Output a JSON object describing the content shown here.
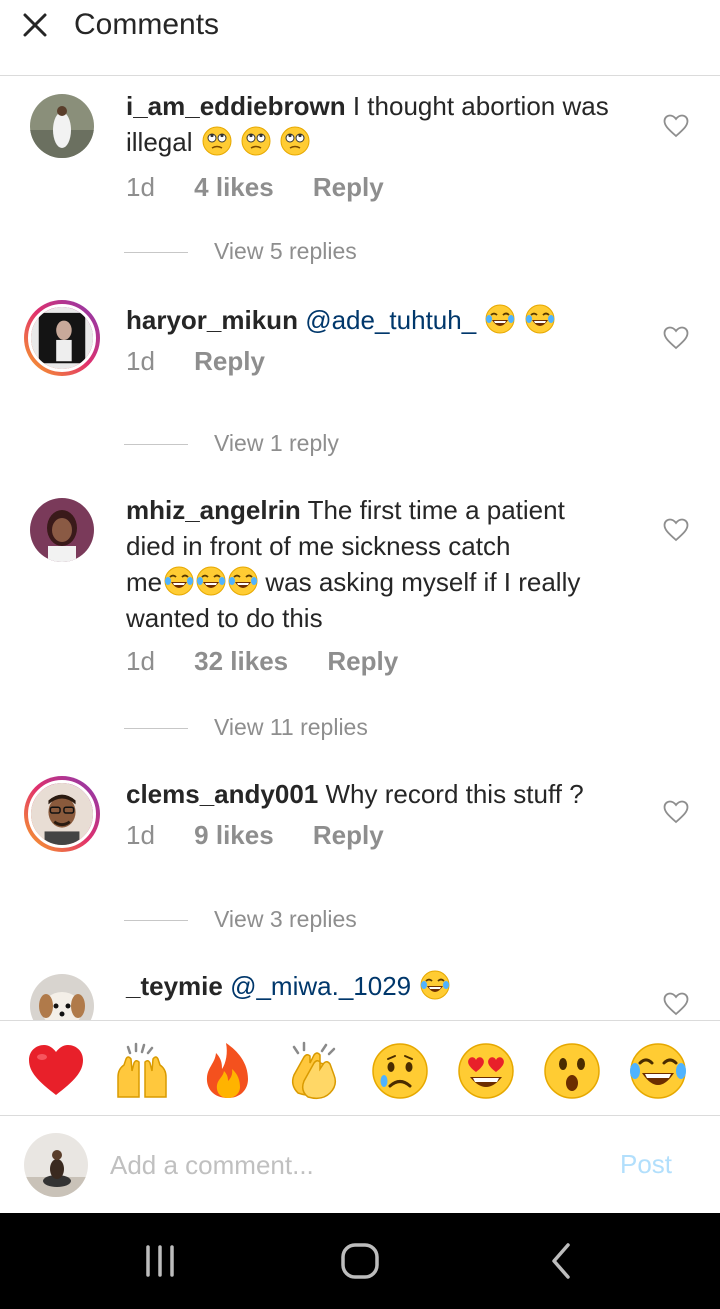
{
  "header": {
    "title": "Comments"
  },
  "comments": [
    {
      "username": "i_am_eddiebrown",
      "text": "I thought abortion was",
      "text_line2": "illegal",
      "emojis": [
        "eye-roll-emoji",
        "eye-roll-emoji",
        "eye-roll-emoji"
      ],
      "time": "1d",
      "likes": "4 likes",
      "reply": "Reply",
      "view_replies": "View 5 replies"
    },
    {
      "username": "haryor_mikun",
      "mention": "@ade_tuhtuh_",
      "emojis": [
        "tears-of-joy-emoji",
        "tears-of-joy-emoji"
      ],
      "time": "1d",
      "reply": "Reply",
      "view_replies": "View 1 reply"
    },
    {
      "username": "mhiz_angelrin",
      "text": "The first time a patient",
      "text_line2": "died in front of me sickness catch",
      "text_line3a": "me",
      "text_line3b": "was asking myself if I really",
      "text_line4": "wanted to do this",
      "emojis": [
        "tears-of-joy-emoji",
        "tears-of-joy-emoji",
        "tears-of-joy-emoji"
      ],
      "time": "1d",
      "likes": "32 likes",
      "reply": "Reply",
      "view_replies": "View 11 replies"
    },
    {
      "username": "clems_andy001",
      "text": "Why record this stuff ?",
      "time": "1d",
      "likes": "9 likes",
      "reply": "Reply",
      "view_replies": "View 3 replies"
    },
    {
      "username": "_teymie",
      "mention": "@_miwa._1029",
      "emojis": [
        "tears-of-joy-emoji"
      ]
    }
  ],
  "reactions": [
    "red-heart",
    "raising-hands",
    "fire",
    "clapping-hands",
    "sad-face",
    "heart-eyes",
    "astonished-face",
    "tears-of-joy"
  ],
  "composer": {
    "placeholder": "Add a comment...",
    "post_label": "Post"
  },
  "colors": {
    "mention": "#00376b",
    "secondary_text": "#8e8e8e",
    "post_disabled": "#b2dffc",
    "divider": "#dbdbdb"
  }
}
